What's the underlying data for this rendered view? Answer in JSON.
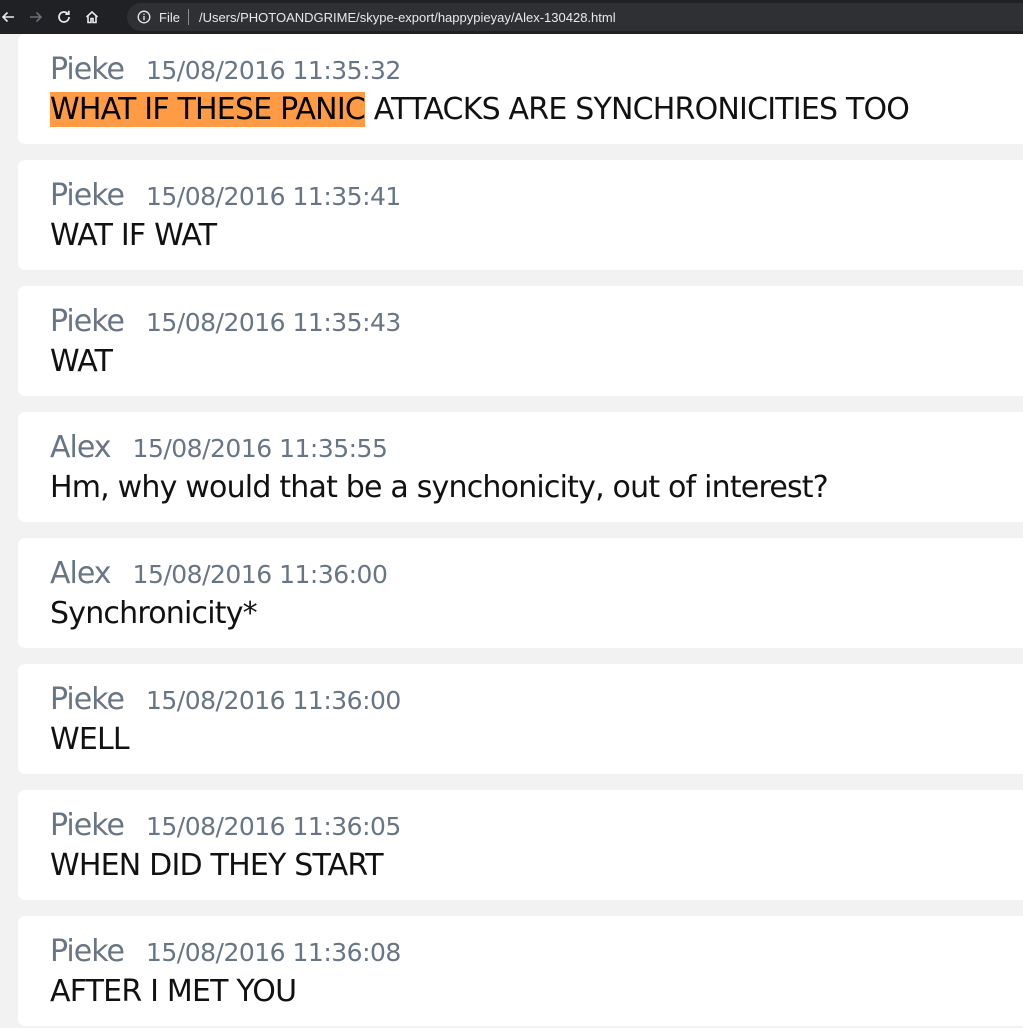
{
  "browser": {
    "scheme_label": "File",
    "url": "/Users/PHOTOANDGRIME/skype-export/happypieyay/Alex-130428.html"
  },
  "messages": [
    {
      "author": "Pieke",
      "time": "15/08/2016 11:35:32",
      "highlight": "WHAT IF THESE PANIC",
      "text": " ATTACKS ARE SYNCHRONICITIES TOO"
    },
    {
      "author": "Pieke",
      "time": "15/08/2016 11:35:41",
      "text": "WAT IF WAT"
    },
    {
      "author": "Pieke",
      "time": "15/08/2016 11:35:43",
      "text": "WAT"
    },
    {
      "author": "Alex",
      "time": "15/08/2016 11:35:55",
      "text": "Hm, why would that be a synchonicity, out of interest?"
    },
    {
      "author": "Alex",
      "time": "15/08/2016 11:36:00",
      "text": "Synchronicity*"
    },
    {
      "author": "Pieke",
      "time": "15/08/2016 11:36:00",
      "text": "WELL"
    },
    {
      "author": "Pieke",
      "time": "15/08/2016 11:36:05",
      "text": "WHEN DID THEY START"
    },
    {
      "author": "Pieke",
      "time": "15/08/2016 11:36:08",
      "text": "AFTER I MET YOU"
    }
  ]
}
